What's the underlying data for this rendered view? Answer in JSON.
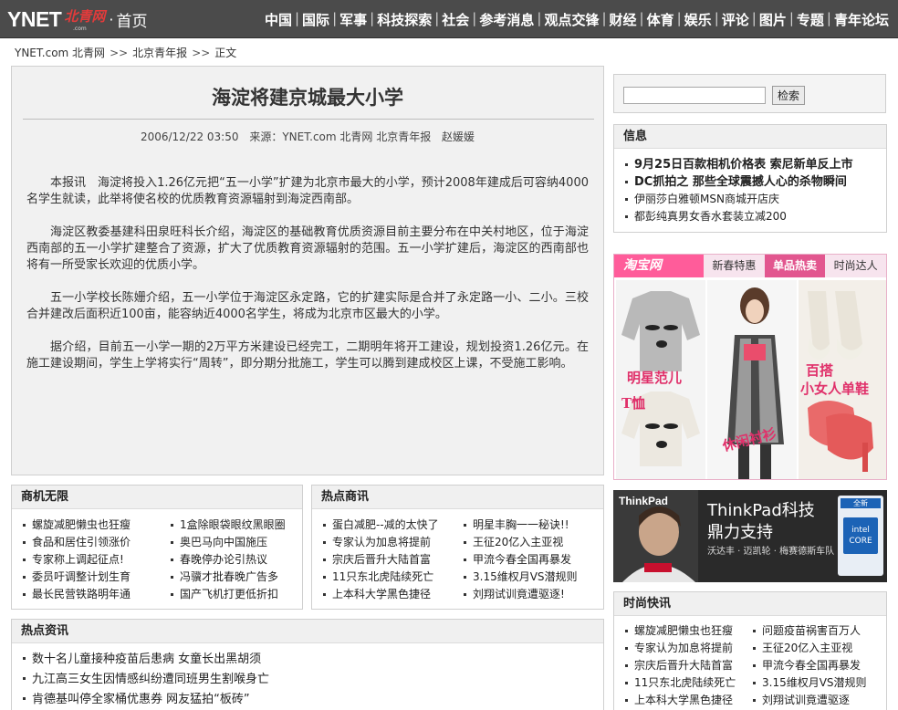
{
  "header": {
    "logo_text": "YNET",
    "logo_cn": "北青网",
    "logo_com": ".com",
    "home_label": "首页",
    "nav": [
      "中国",
      "国际",
      "军事",
      "科技探索",
      "社会",
      "参考消息",
      "观点交锋",
      "财经",
      "体育",
      "娱乐",
      "评论",
      "图片",
      "专题",
      "青年论坛"
    ]
  },
  "breadcrumb": {
    "items": [
      "YNET.com 北青网",
      "北京青年报",
      "正文"
    ],
    "separator": ">>"
  },
  "article": {
    "title": "海淀将建京城最大小学",
    "date": "2006/12/22 03:50",
    "source_label": "来源：YNET.com 北青网  北京青年报",
    "author": "赵媛媛",
    "paragraphs": [
      "本报讯　海淀将投入1.26亿元把“五一小学”扩建为北京市最大的小学，预计2008年建成后可容纳4000名学生就读，此举将使名校的优质教育资源辐射到海淀西南部。",
      "海淀区教委基建科田泉旺科长介绍，海淀区的基础教育优质资源目前主要分布在中关村地区，位于海淀西南部的五一小学扩建整合了资源，扩大了优质教育资源辐射的范围。五一小学扩建后，海淀区的西南部也将有一所受家长欢迎的优质小学。",
      "五一小学校长陈姗介绍，五一小学位于海淀区永定路，它的扩建实际是合并了永定路一小、二小。三校合并建改后面积近100亩，能容纳近4000名学生，将成为北京市区最大的小学。",
      "据介绍，目前五一小学一期的2万平方米建设已经完工，二期明年将开工建设，规划投资1.26亿元。在施工建设期间，学生上学将实行“周转”，即分期分批施工，学生可以腾到建成校区上课，不受施工影响。"
    ]
  },
  "search": {
    "value": "",
    "button_label": "检索"
  },
  "info_box": {
    "title": "信息",
    "items": [
      {
        "text": "9月25日百款相机价格表 索尼新单反上市",
        "bold": true
      },
      {
        "text": "DC抓拍之 那些全球震撼人心的杀物瞬间",
        "bold": true
      },
      {
        "text": "伊丽莎白雅顿MSN商城开店庆",
        "bold": false
      },
      {
        "text": "都彭纯真男女香水套装立减200",
        "bold": false
      }
    ]
  },
  "taobao_ad": {
    "logo": "淘宝网",
    "tabs": [
      "新春特惠",
      "单品热卖",
      "时尚达人"
    ],
    "active_tab": 1,
    "captions": [
      "明星范儿",
      "T恤",
      "休闲衬衫",
      "百搭",
      "小女人单鞋"
    ],
    "accent_color": "#e2568f"
  },
  "thinkpad_ad": {
    "brand": "ThinkPad",
    "line1": "ThinkPad科技",
    "line2": "鼎力支持",
    "line3": "沃达丰 · 迈凯轮 · 梅赛德斯车队",
    "badge_new": "全新",
    "badge_chip": "intel CORE"
  },
  "biz_box": {
    "title": "商机无限",
    "col1": [
      "螺旋减肥懒虫也狂瘦",
      "食品和居住引领涨价",
      "专家称上调起征点!",
      "委员吁调整计划生育",
      "最长民营铁路明年通"
    ],
    "col2": [
      "1盒除眼袋眼纹黑眼圈",
      "奥巴马向中国施压",
      "春晚停办论引热议",
      "冯骥才批春晚广告多",
      "国产飞机打更低折扣"
    ]
  },
  "hot_biz_box": {
    "title": "热点商讯",
    "col1": [
      "蛋白减肥--减的太快了",
      "专家认为加息将提前",
      "宗庆后晋升大陆首富",
      "11只东北虎陆续死亡",
      "上本科大学黑色捷径"
    ],
    "col2": [
      "明星丰胸一一秘诀!!",
      "王征20亿入主亚视",
      "甲流今春全国再暴发",
      "3.15维权月VS潜规则",
      "刘翔试训竟遭驱逐!"
    ]
  },
  "fashion_box": {
    "title": "时尚快讯",
    "col1": [
      "螺旋减肥懒虫也狂瘦",
      "专家认为加息将提前",
      "宗庆后晋升大陆首富",
      "11只东北虎陆续死亡",
      "上本科大学黑色捷径"
    ],
    "col2": [
      "问题疫苗祸害百万人",
      "王征20亿入主亚视",
      "甲流今春全国再暴发",
      "3.15维权月VS潜规则",
      "刘翔试训竟遭驱逐"
    ]
  },
  "hot_news_box": {
    "title": "热点资讯",
    "items": [
      "数十名儿童接种疫苗后患病 女童长出黑胡须",
      "九江高三女生因情感纠纷遭同班男生割喉身亡",
      "肯德基叫停全家桶优惠券 网友猛拍“板砖”"
    ]
  }
}
